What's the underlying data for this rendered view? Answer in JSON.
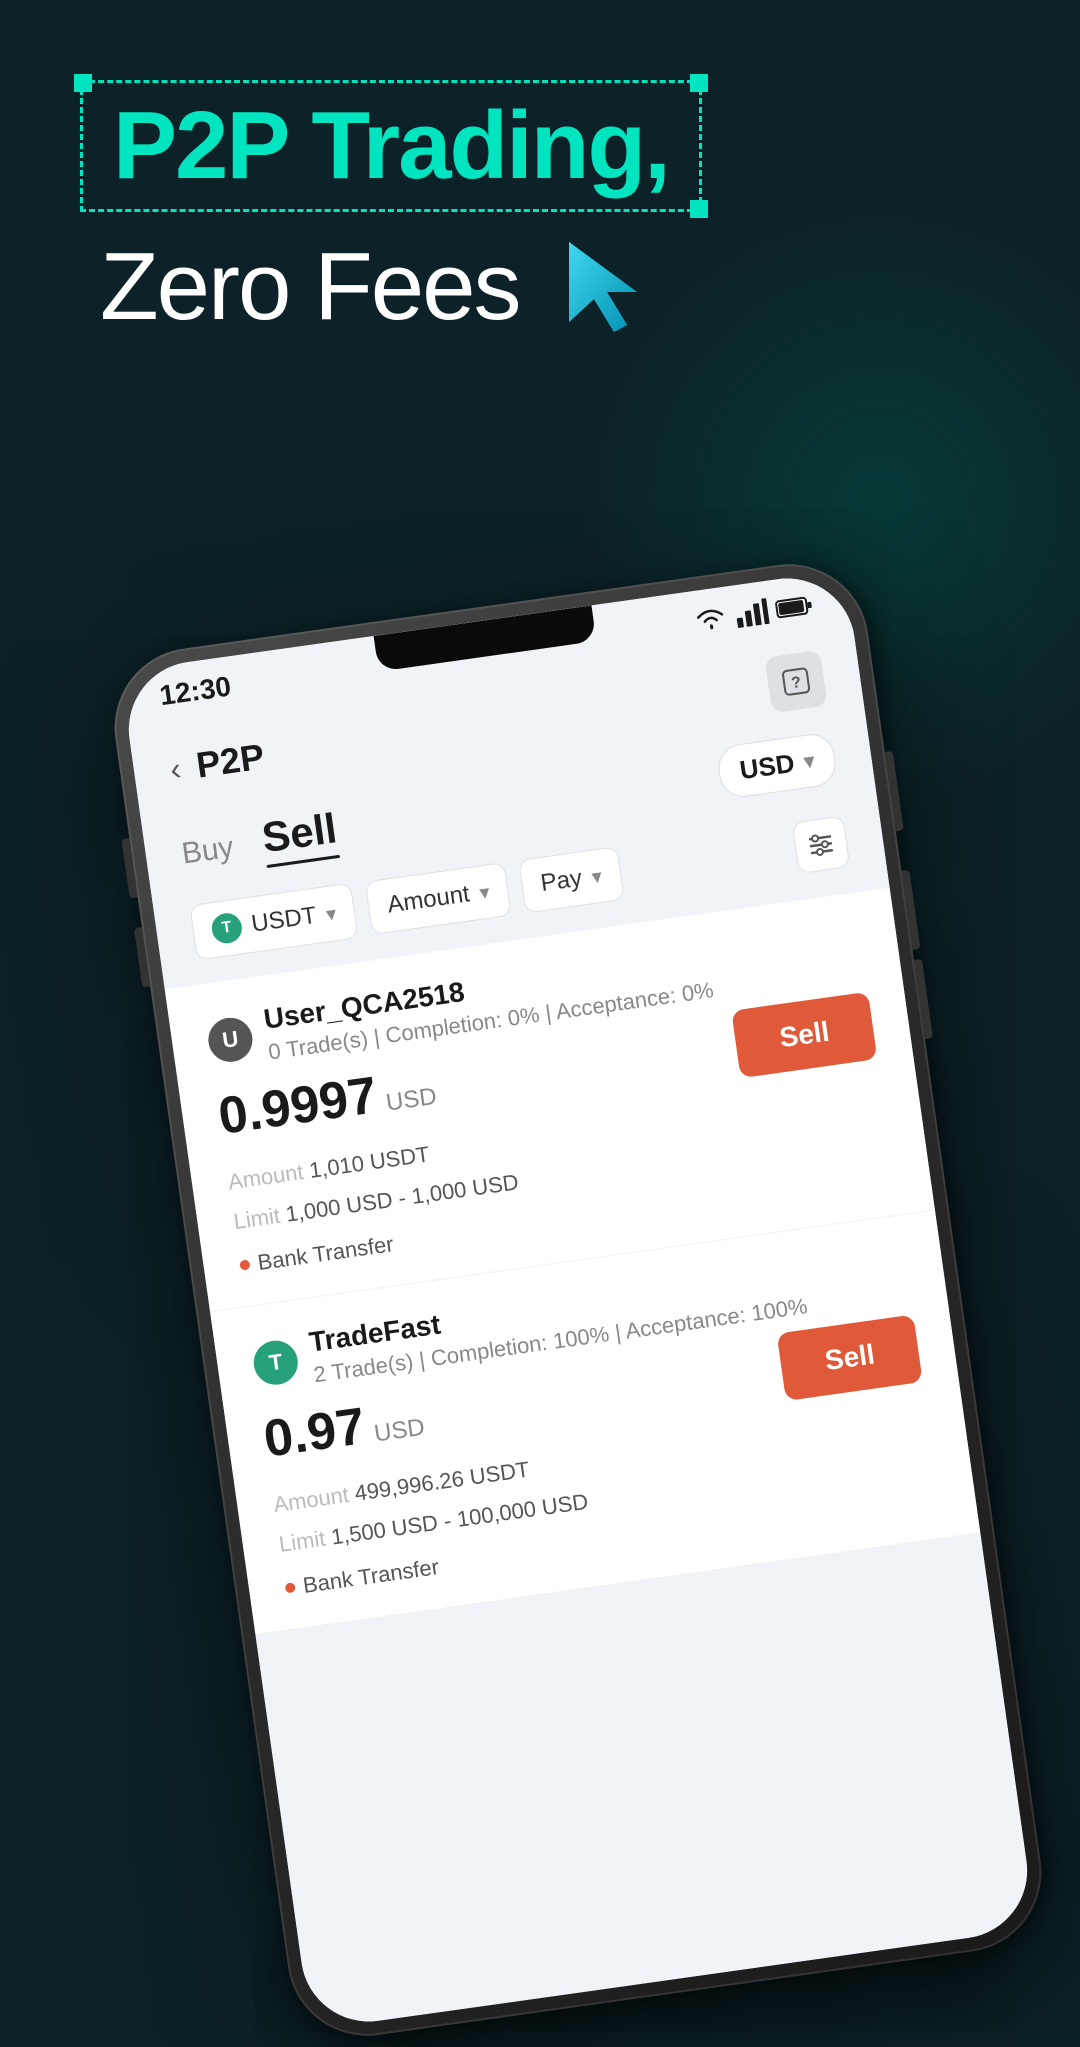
{
  "background": {
    "color": "#0d2228"
  },
  "header": {
    "title_line1": "P2P Trading,",
    "title_line2": "Zero Fees"
  },
  "phone": {
    "status_bar": {
      "time": "12:30",
      "wifi": "wifi",
      "signal": "signal",
      "battery": "battery"
    },
    "app": {
      "title": "P2P",
      "help_icon": "?",
      "tabs": {
        "buy": "Buy",
        "sell": "Sell"
      },
      "currency": "USD",
      "currency_chevron": "▼",
      "filters": {
        "coin": "USDT",
        "amount": "Amount",
        "pay": "Pay"
      },
      "listings": [
        {
          "username": "User_QCA2518",
          "avatar_letter": "U",
          "avatar_color": "#555555",
          "trades": "0 Trade(s)",
          "completion": "Completion: 0%",
          "acceptance": "Acceptance: 0%",
          "price": "0.9997",
          "price_currency": "USD",
          "amount_label": "Amount",
          "amount_value": "1,010 USDT",
          "limit_label": "Limit",
          "limit_value": "1,000 USD - 1,000 USD",
          "payment_method": "Bank Transfer",
          "sell_button": "Sell"
        },
        {
          "username": "TradeFast",
          "avatar_letter": "T",
          "avatar_color": "#26a17b",
          "trades": "2 Trade(s)",
          "completion": "Completion: 100%",
          "acceptance": "Acceptance: 100%",
          "price": "0.97",
          "price_currency": "USD",
          "amount_label": "Amount",
          "amount_value": "499,996.26 USDT",
          "limit_label": "Limit",
          "limit_value": "1,500 USD - 100,000 USD",
          "payment_method": "Bank Transfer",
          "sell_button": "Sell"
        }
      ]
    }
  }
}
